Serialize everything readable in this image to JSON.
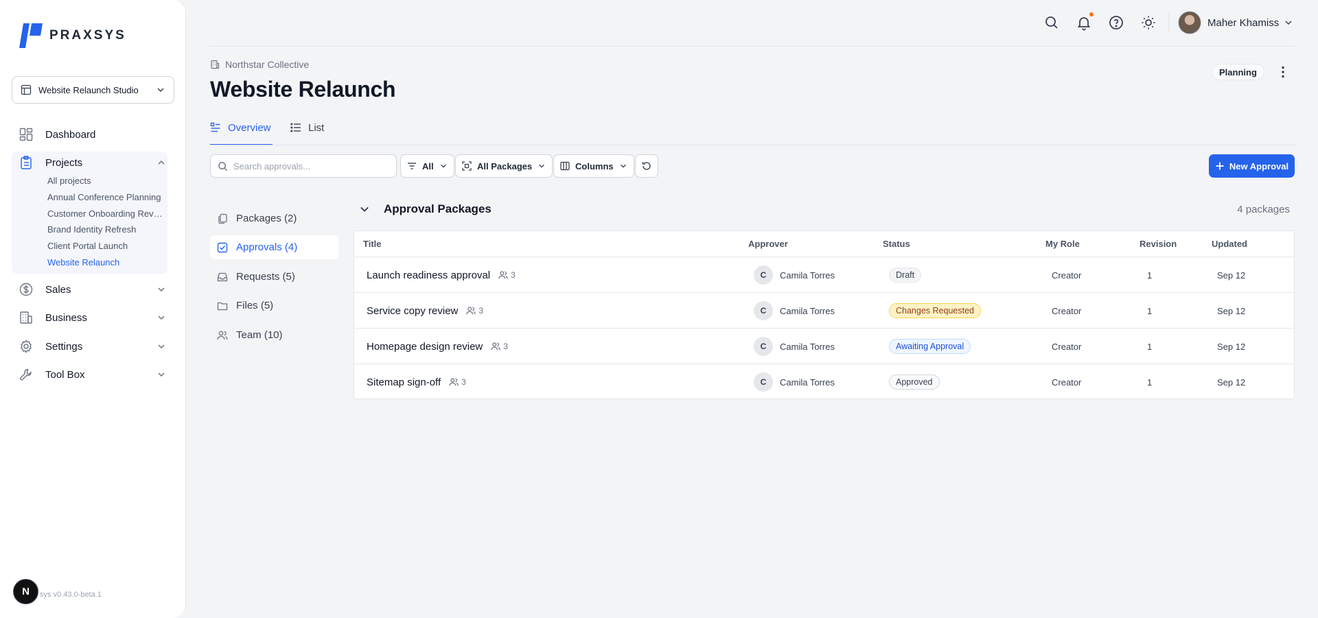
{
  "brand": {
    "name": "PRAXSYS",
    "accent": "#2563eb"
  },
  "workspace": {
    "label": "Website Relaunch Studio"
  },
  "sidebar": {
    "dashboard": "Dashboard",
    "projects": {
      "label": "Projects",
      "items": [
        "All projects",
        "Annual Conference Planning",
        "Customer Onboarding Revamp",
        "Brand Identity Refresh",
        "Client Portal Launch",
        "Website Relaunch"
      ]
    },
    "sales": "Sales",
    "business": "Business",
    "settings": "Settings",
    "toolbox": "Tool Box",
    "version": "sys v0.43.0-beta.1",
    "dev_badge": "N"
  },
  "header": {
    "user_name": "Maher Khamiss",
    "breadcrumb": "Northstar Collective",
    "title": "Website Relaunch",
    "status": "Planning"
  },
  "tabs": {
    "overview": "Overview",
    "list": "List"
  },
  "toolbar": {
    "search_placeholder": "Search approvals...",
    "filter_all": "All",
    "packages_filter": "All Packages",
    "columns": "Columns",
    "new_approval": "New Approval"
  },
  "subnav": {
    "packages": "Packages (2)",
    "approvals": "Approvals (4)",
    "requests": "Requests (5)",
    "files": "Files (5)",
    "team": "Team (10)"
  },
  "section": {
    "title": "Approval Packages",
    "count": "4 packages"
  },
  "table": {
    "headers": {
      "title": "Title",
      "approver": "Approver",
      "status": "Status",
      "role": "My Role",
      "revision": "Revision",
      "updated": "Updated"
    },
    "rows": [
      {
        "title": "Launch readiness approval",
        "members": "3",
        "approver_initial": "C",
        "approver": "Camila Torres",
        "status": "Draft",
        "role": "Creator",
        "revision": "1",
        "updated": "Sep 12"
      },
      {
        "title": "Service copy review",
        "members": "3",
        "approver_initial": "C",
        "approver": "Camila Torres",
        "status": "Changes Requested",
        "role": "Creator",
        "revision": "1",
        "updated": "Sep 12"
      },
      {
        "title": "Homepage design review",
        "members": "3",
        "approver_initial": "C",
        "approver": "Camila Torres",
        "status": "Awaiting Approval",
        "role": "Creator",
        "revision": "1",
        "updated": "Sep 12"
      },
      {
        "title": "Sitemap sign-off",
        "members": "3",
        "approver_initial": "C",
        "approver": "Camila Torres",
        "status": "Approved",
        "role": "Creator",
        "revision": "1",
        "updated": "Sep 12"
      }
    ]
  }
}
